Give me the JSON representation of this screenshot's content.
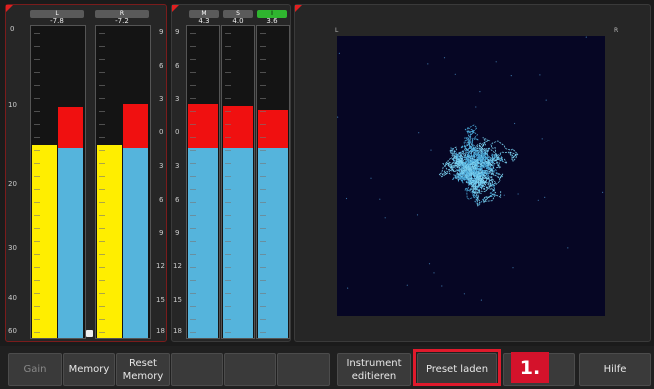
{
  "ppm": {
    "channels": [
      {
        "label": "L",
        "value": "-7.8"
      },
      {
        "label": "R",
        "value": "-7.2"
      }
    ],
    "left_scale": [
      "0",
      "10",
      "20",
      "30",
      "40",
      "60"
    ],
    "right_scale": [
      "9",
      "6",
      "3",
      "0",
      "3",
      "6",
      "9",
      "12",
      "15",
      "18"
    ],
    "bars": [
      {
        "type": "yellow",
        "fill": 0.62
      },
      {
        "type": "blue",
        "fill": 0.61,
        "peak": 0.13
      },
      {
        "type": "yellow",
        "fill": 0.62
      },
      {
        "type": "blue",
        "fill": 0.61,
        "peak": 0.14
      }
    ]
  },
  "ms": {
    "channels": [
      {
        "label": "M",
        "value": "4.3",
        "active": false
      },
      {
        "label": "S",
        "value": "4.0",
        "active": false
      },
      {
        "label": "I",
        "value": "3.6",
        "active": true
      }
    ],
    "scale": [
      "9",
      "6",
      "3",
      "0",
      "3",
      "6",
      "9",
      "12",
      "15",
      "18"
    ],
    "bars": [
      {
        "fill": 0.61,
        "peak": 0.14
      },
      {
        "fill": 0.61,
        "peak": 0.135
      },
      {
        "fill": 0.61,
        "peak": 0.12
      }
    ]
  },
  "goniometer": {
    "left_label": "L",
    "right_label": "R"
  },
  "softkeys": [
    {
      "id": "gain",
      "label": "Gain",
      "disabled": true
    },
    {
      "id": "memory",
      "label": "Memory",
      "disabled": false
    },
    {
      "id": "reset-memory",
      "label": "Reset\nMemory",
      "disabled": false
    },
    {
      "id": "empty-4",
      "label": "",
      "disabled": false
    },
    {
      "id": "empty-5",
      "label": "",
      "disabled": false
    },
    {
      "id": "empty-6",
      "label": "",
      "disabled": false
    },
    {
      "id": "instrument-edit",
      "label": "Instrument\neditieren",
      "disabled": false
    },
    {
      "id": "preset-load",
      "label": "Preset laden",
      "disabled": false
    },
    {
      "id": "menu",
      "label": "nü",
      "disabled": false
    },
    {
      "id": "help",
      "label": "Hilfe",
      "disabled": false
    }
  ],
  "annotation": {
    "step": "1."
  },
  "colors": {
    "accent_red": "#e01a2c",
    "level_yellow": "#ffee00",
    "level_blue": "#55b4dc",
    "peak_red": "#f01010",
    "active_green": "#2fb52f"
  }
}
